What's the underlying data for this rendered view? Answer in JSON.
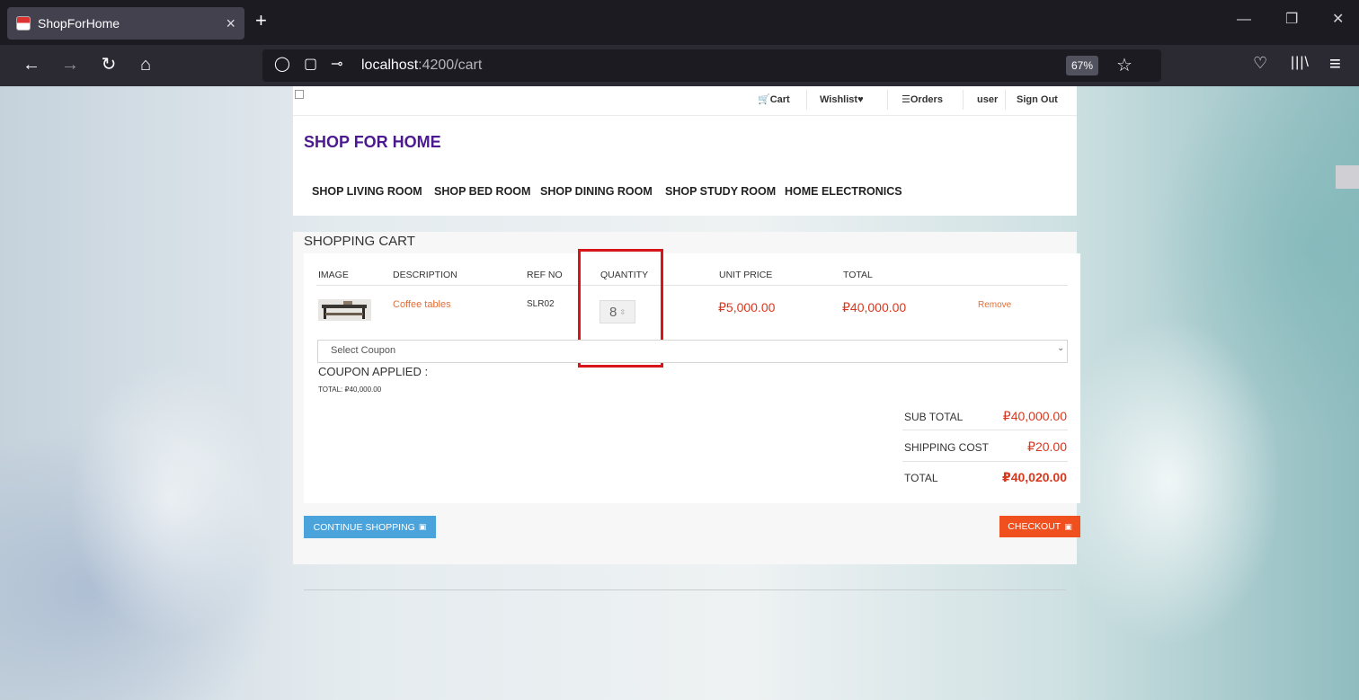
{
  "browser": {
    "tab_title": "ShopForHome",
    "tab_close": "×",
    "new_tab": "+",
    "url_host": "localhost",
    "url_path": ":4200/cart",
    "zoom": "67%",
    "window_controls": {
      "minimize": "—",
      "restore": "❐",
      "close": "✕"
    }
  },
  "site": {
    "topnav": [
      "Cart",
      "Wishlist",
      "Orders",
      "user",
      "Sign Out"
    ],
    "brand": "SHOP FOR HOME",
    "categories": [
      "SHOP LIVING ROOM",
      "SHOP BED ROOM",
      "SHOP DINING ROOM",
      "SHOP STUDY ROOM",
      "HOME ELECTRONICS"
    ]
  },
  "cart": {
    "title": "SHOPPING CART",
    "columns": [
      "IMAGE",
      "DESCRIPTION",
      "REF NO",
      "QUANTITY",
      "UNIT PRICE",
      "TOTAL"
    ],
    "items": [
      {
        "description": "Coffee tables",
        "ref_no": "SLR02",
        "quantity": "8",
        "unit_price": "₽5,000.00",
        "total": "₽40,000.00",
        "remove": "Remove"
      }
    ],
    "coupon_placeholder": "Select Coupon",
    "coupon_applied": "COUPON APPLIED :",
    "coupon_total": "TOTAL: ₽40,000.00",
    "summary": {
      "subtotal_label": "SUB TOTAL",
      "subtotal": "₽40,000.00",
      "shipping_label": "SHIPPING COST",
      "shipping": "₽20.00",
      "total_label": "TOTAL",
      "total": "₽40,020.00"
    },
    "continue_label": "CONTINUE SHOPPING",
    "checkout_label": "CHECKOUT"
  },
  "colors": {
    "brand": "#4b1a8e",
    "price": "#d9381e",
    "continue_btn": "#4ba3db",
    "checkout_btn": "#f0501e",
    "highlight": "#d7151b"
  }
}
